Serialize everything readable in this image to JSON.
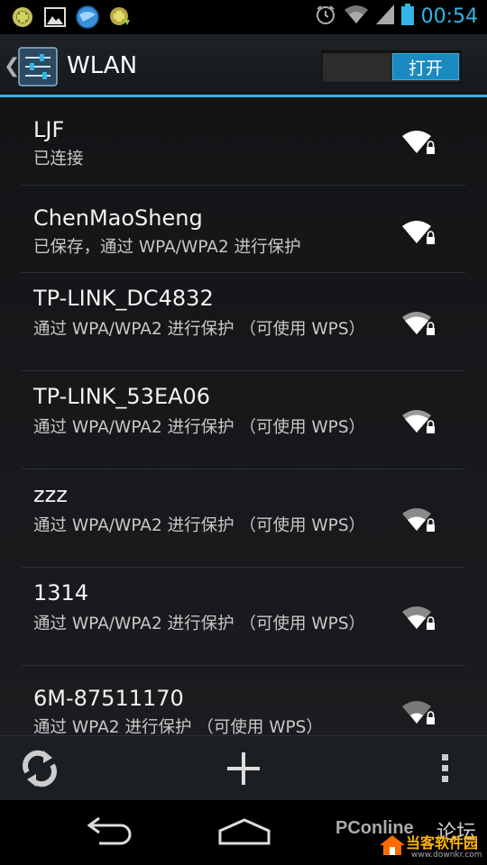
{
  "status_bar": {
    "time": "00:54",
    "left_icons": [
      "android-notification-icon",
      "image-notification-icon",
      "browser-notification-icon",
      "download-notification-icon"
    ],
    "right_icons": [
      "alarm-icon",
      "wifi-signal-icon",
      "cell-signal-icon",
      "battery-icon"
    ]
  },
  "action_bar": {
    "title": "WLAN",
    "toggle_label": "打开",
    "accent_color": "#33b5e5"
  },
  "networks": [
    {
      "ssid": "LJF",
      "summary": "已连接",
      "secured": true
    },
    {
      "ssid": "ChenMaoSheng",
      "summary": "已保存，通过 WPA/WPA2 进行保护",
      "secured": true
    },
    {
      "ssid": "TP-LINK_DC4832",
      "summary": "通过 WPA/WPA2 进行保护 （可使用 WPS）",
      "secured": true
    },
    {
      "ssid": "TP-LINK_53EA06",
      "summary": "通过 WPA/WPA2 进行保护 （可使用 WPS）",
      "secured": true
    },
    {
      "ssid": "zzz",
      "summary": "通过 WPA/WPA2 进行保护 （可使用 WPS）",
      "secured": true
    },
    {
      "ssid": "1314",
      "summary": "通过 WPA/WPA2 进行保护 （可使用 WPS）",
      "secured": true
    },
    {
      "ssid": "6M-87511170",
      "summary": "通过 WPA2 进行保护 （可使用 WPS）",
      "secured": true
    }
  ],
  "bottom_bar": {
    "icons": [
      "scan-refresh-icon",
      "add-network-icon",
      "overflow-menu-icon"
    ]
  },
  "nav_bar": {
    "icons": [
      "back-icon",
      "home-icon"
    ]
  },
  "watermark": {
    "text_pconline": "PConline",
    "text_forum": "论坛",
    "text_site": "当客软件园",
    "text_url": "www.downkr.com"
  }
}
